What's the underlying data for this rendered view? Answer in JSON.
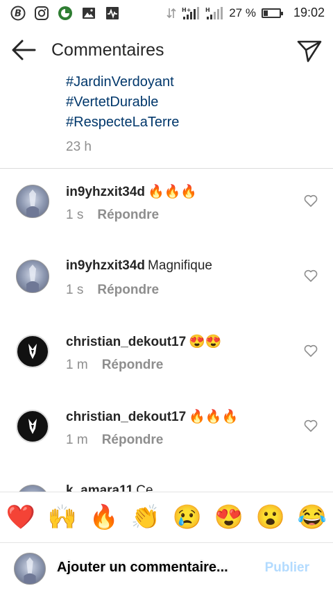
{
  "status_bar": {
    "battery_percent": "27 %",
    "battery_level": 0.27,
    "time": "19:02",
    "left_icons": [
      "bitcoin-icon",
      "instagram-icon",
      "timer-icon",
      "gallery-icon",
      "activity-icon"
    ]
  },
  "header": {
    "title": "Commentaires"
  },
  "caption": {
    "hashtags": [
      "#JardinVerdoyant",
      "#VertetDurable",
      "#RespecteLaTerre"
    ],
    "time": "23 h"
  },
  "comments": [
    {
      "username": "in9yhzxit34d",
      "text": "🔥🔥🔥",
      "time": "1 s",
      "reply": "Répondre",
      "avatar": "photo"
    },
    {
      "username": "in9yhzxit34d",
      "text": "Magnifique",
      "time": "1 s",
      "reply": "Répondre",
      "avatar": "photo"
    },
    {
      "username": "christian_dekout17",
      "text": "😍😍",
      "time": "1 m",
      "reply": "Répondre",
      "avatar": "dark"
    },
    {
      "username": "christian_dekout17",
      "text": "🔥🔥🔥",
      "time": "1 m",
      "reply": "Répondre",
      "avatar": "dark"
    }
  ],
  "partial_comment": {
    "username": "k_amara11",
    "text": "Ce"
  },
  "emoji_bar": [
    "❤️",
    "🙌",
    "🔥",
    "👏",
    "😢",
    "😍",
    "😮",
    "😂"
  ],
  "composer": {
    "placeholder": "Ajouter un commentaire...",
    "publish_label": "Publier"
  }
}
